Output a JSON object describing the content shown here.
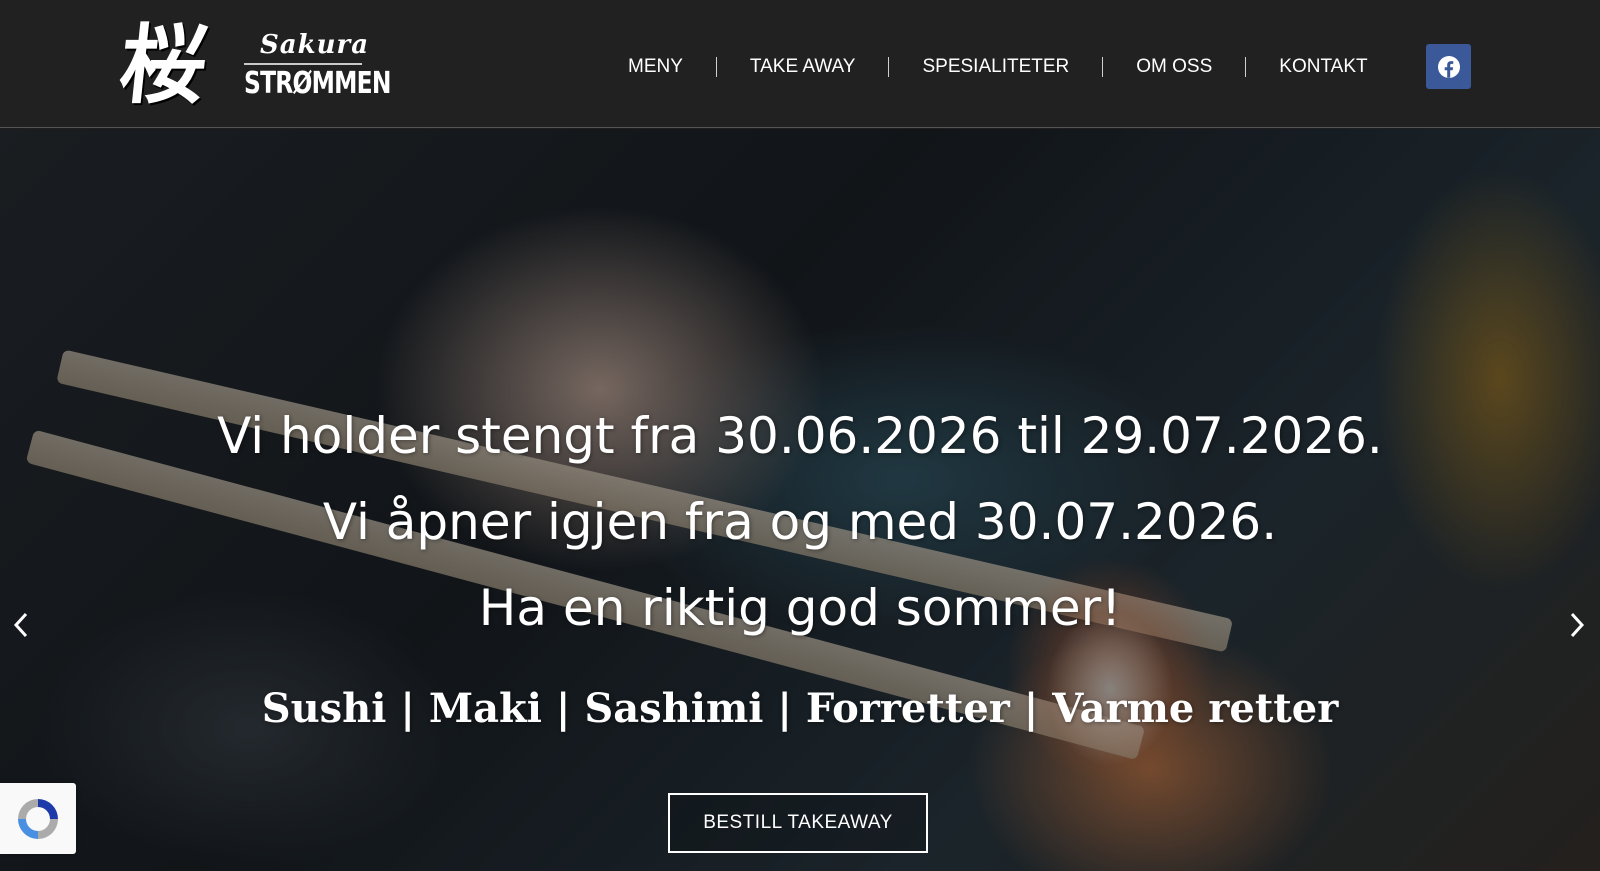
{
  "brand": {
    "kanji": "桜",
    "script_name": "Sakura",
    "name": "STRØMMEN"
  },
  "nav": {
    "items": [
      {
        "label": "MENY"
      },
      {
        "label": "TAKE AWAY"
      },
      {
        "label": "SPESIALITETER"
      },
      {
        "label": "OM OSS"
      },
      {
        "label": "KONTAKT"
      }
    ],
    "social_icon": "facebook-icon",
    "social_color": "#3b5998"
  },
  "hero": {
    "lines": [
      "Vi holder stengt fra 30.06.2026 til 29.07.2026.",
      "Vi åpner igjen fra og med 30.07.2026.",
      "Ha en riktig god sommer!"
    ],
    "categories": "Sushi | Maki | Sashimi | Forretter | Varme retter",
    "cta_label": "BESTILL TAKEAWAY",
    "prev_icon": "chevron-left-icon",
    "next_icon": "chevron-right-icon"
  },
  "colors": {
    "header_bg": "#212121",
    "text": "#ffffff"
  }
}
